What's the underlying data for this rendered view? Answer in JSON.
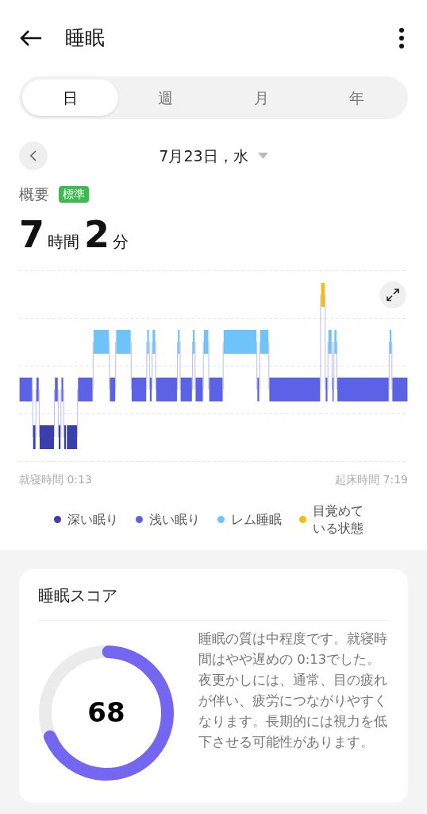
{
  "header": {
    "title": "睡眠"
  },
  "tabs": [
    {
      "label": "日",
      "selected": true
    },
    {
      "label": "週",
      "selected": false
    },
    {
      "label": "月",
      "selected": false
    },
    {
      "label": "年",
      "selected": false
    }
  ],
  "date": "7月23日，水",
  "summary": {
    "label": "概要",
    "badge": "標準",
    "hours": "7",
    "hours_unit": "時間",
    "minutes": "2",
    "minutes_unit": "分"
  },
  "chart": {
    "start": "就寝時間 0:13",
    "end": "起床時間 7:19"
  },
  "legend": [
    {
      "label": "深い眠り",
      "color": "#3b3fae"
    },
    {
      "label": "浅い眠り",
      "color": "#5c62e6"
    },
    {
      "label": "レム睡眠",
      "color": "#6ec4f8"
    },
    {
      "label": "目覚めている状態",
      "color": "#f6bb0e"
    }
  ],
  "score": {
    "title": "睡眠スコア",
    "value": "68",
    "text": "睡眠の質は中程度です。就寝時間はやや遅めの 0:13でした。夜更かしには、通常、目の疲れが伴い、疲労につながりやすくなります。長期的には視力を低下させる可能性があります。"
  }
}
